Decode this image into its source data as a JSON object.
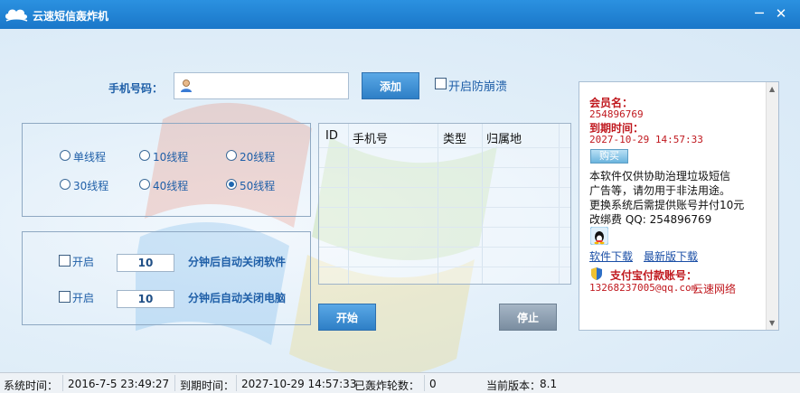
{
  "window": {
    "title": "云速短信轰炸机",
    "minimize_symbol": "─",
    "close_symbol": "✕"
  },
  "form": {
    "phone_label": "手机号码：",
    "phone_value": "",
    "add_button": "添加",
    "anti_crash_label": "开启防崩溃"
  },
  "threads": {
    "options": [
      "单线程",
      "10线程",
      "20线程",
      "30线程",
      "40线程",
      "50线程"
    ],
    "selected": "50线程"
  },
  "auto": {
    "row1": {
      "enable_label": "开启",
      "minutes": "10",
      "text": "分钟后自动关闭软件"
    },
    "row2": {
      "enable_label": "开启",
      "minutes": "10",
      "text": "分钟后自动关闭电脑"
    }
  },
  "table": {
    "columns": [
      "ID",
      "手机号",
      "类型",
      "归属地"
    ],
    "rows": []
  },
  "buttons": {
    "start": "开始",
    "stop": "停止"
  },
  "side": {
    "member_label": "会员名：",
    "member_value": "254896769",
    "expiry_label": "到期时间：",
    "expiry_value": "2027-10-29 14:57:33",
    "buy_button": "购买",
    "notice_line1": "本软件仅供协助治理垃圾短信",
    "notice_line2": "广告等，请勿用于非法用途。",
    "notice_line3": "更换系统后需提供账号并付10元",
    "notice_line4": "改绑费 QQ: 254896769",
    "download_link": "软件下载",
    "latest_link": "最新版下载",
    "alipay_label": "支付宝付款账号：",
    "alipay_value": "13268237005@qq.com",
    "brand": "云速网络"
  },
  "status": {
    "system_time_label": "系统时间：",
    "system_time_value": "2016-7-5 23:49:27",
    "expiry_label": "到期时间：",
    "expiry_value": "2027-10-29 14:57:33",
    "rounds_label": "已轰炸轮数：",
    "rounds_value": "0",
    "version_label": "当前版本：",
    "version_value": "8.1"
  },
  "icons": {
    "logo": "cloud-icon",
    "user": "user-icon",
    "qq": "qq-penguin-icon",
    "shield": "shield-icon"
  },
  "colors": {
    "titlebar": "#1f82d2",
    "accent_blue": "#1f5fa8",
    "red_text": "#c0181e"
  }
}
